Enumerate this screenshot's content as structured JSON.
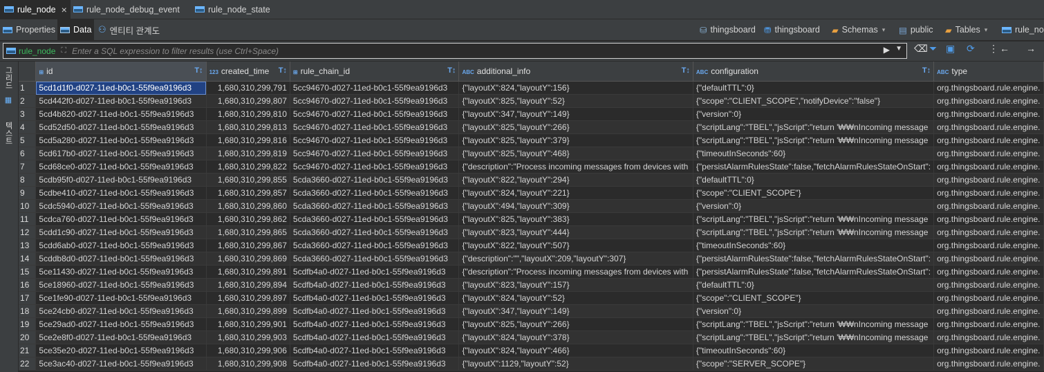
{
  "tabs": [
    {
      "label": "rule_node",
      "active": true,
      "close": "×"
    },
    {
      "label": "rule_node_debug_event",
      "active": false
    },
    {
      "label": "rule_node_state",
      "active": false
    }
  ],
  "toolbar": {
    "properties": "Properties",
    "data": "Data",
    "er": "엔티티 관계도",
    "conn1": "thingsboard",
    "conn2": "thingsboard",
    "schemas": "Schemas",
    "schema": "public",
    "tables": "Tables",
    "table": "rule_no"
  },
  "filter": {
    "table_name": "rule_node",
    "placeholder": "Enter a SQL expression to filter results (use Ctrl+Space)"
  },
  "side_tabs": [
    "그리드",
    "텍스트"
  ],
  "columns": [
    {
      "type": "id",
      "name": "id"
    },
    {
      "type": "123",
      "name": "created_time"
    },
    {
      "type": "id",
      "name": "rule_chain_id"
    },
    {
      "type": "ABC",
      "name": "additional_info"
    },
    {
      "type": "ABC",
      "name": "configuration"
    },
    {
      "type": "ABC",
      "name": "type"
    }
  ],
  "rows": [
    [
      "1",
      "5cd1d1f0-d027-11ed-b0c1-55f9ea9196d3",
      "1,680,310,299,791",
      "5cc94670-d027-11ed-b0c1-55f9ea9196d3",
      "{\"layoutX\":824,\"layoutY\":156}",
      "{\"defaultTTL\":0}",
      "org.thingsboard.rule.engine."
    ],
    [
      "2",
      "5cd442f0-d027-11ed-b0c1-55f9ea9196d3",
      "1,680,310,299,807",
      "5cc94670-d027-11ed-b0c1-55f9ea9196d3",
      "{\"layoutX\":825,\"layoutY\":52}",
      "{\"scope\":\"CLIENT_SCOPE\",\"notifyDevice\":\"false\"}",
      "org.thingsboard.rule.engine."
    ],
    [
      "3",
      "5cd4b820-d027-11ed-b0c1-55f9ea9196d3",
      "1,680,310,299,810",
      "5cc94670-d027-11ed-b0c1-55f9ea9196d3",
      "{\"layoutX\":347,\"layoutY\":149}",
      "{\"version\":0}",
      "org.thingsboard.rule.engine."
    ],
    [
      "4",
      "5cd52d50-d027-11ed-b0c1-55f9ea9196d3",
      "1,680,310,299,813",
      "5cc94670-d027-11ed-b0c1-55f9ea9196d3",
      "{\"layoutX\":825,\"layoutY\":266}",
      "{\"scriptLang\":\"TBEL\",\"jsScript\":\"return '₩₩nIncoming message",
      "org.thingsboard.rule.engine."
    ],
    [
      "5",
      "5cd5a280-d027-11ed-b0c1-55f9ea9196d3",
      "1,680,310,299,816",
      "5cc94670-d027-11ed-b0c1-55f9ea9196d3",
      "{\"layoutX\":825,\"layoutY\":379}",
      "{\"scriptLang\":\"TBEL\",\"jsScript\":\"return '₩₩nIncoming message",
      "org.thingsboard.rule.engine."
    ],
    [
      "6",
      "5cd617b0-d027-11ed-b0c1-55f9ea9196d3",
      "1,680,310,299,819",
      "5cc94670-d027-11ed-b0c1-55f9ea9196d3",
      "{\"layoutX\":825,\"layoutY\":468}",
      "{\"timeoutInSeconds\":60}",
      "org.thingsboard.rule.engine."
    ],
    [
      "7",
      "5cd68ce0-d027-11ed-b0c1-55f9ea9196d3",
      "1,680,310,299,822",
      "5cc94670-d027-11ed-b0c1-55f9ea9196d3",
      "{\"description\":\"Process incoming messages from devices with",
      "{\"persistAlarmRulesState\":false,\"fetchAlarmRulesStateOnStart\":",
      "org.thingsboard.rule.engine."
    ],
    [
      "8",
      "5cdb95f0-d027-11ed-b0c1-55f9ea9196d3",
      "1,680,310,299,855",
      "5cda3660-d027-11ed-b0c1-55f9ea9196d3",
      "{\"layoutX\":822,\"layoutY\":294}",
      "{\"defaultTTL\":0}",
      "org.thingsboard.rule.engine."
    ],
    [
      "9",
      "5cdbe410-d027-11ed-b0c1-55f9ea9196d3",
      "1,680,310,299,857",
      "5cda3660-d027-11ed-b0c1-55f9ea9196d3",
      "{\"layoutX\":824,\"layoutY\":221}",
      "{\"scope\":\"CLIENT_SCOPE\"}",
      "org.thingsboard.rule.engine."
    ],
    [
      "10",
      "5cdc5940-d027-11ed-b0c1-55f9ea9196d3",
      "1,680,310,299,860",
      "5cda3660-d027-11ed-b0c1-55f9ea9196d3",
      "{\"layoutX\":494,\"layoutY\":309}",
      "{\"version\":0}",
      "org.thingsboard.rule.engine."
    ],
    [
      "11",
      "5cdca760-d027-11ed-b0c1-55f9ea9196d3",
      "1,680,310,299,862",
      "5cda3660-d027-11ed-b0c1-55f9ea9196d3",
      "{\"layoutX\":825,\"layoutY\":383}",
      "{\"scriptLang\":\"TBEL\",\"jsScript\":\"return '₩₩nIncoming message",
      "org.thingsboard.rule.engine."
    ],
    [
      "12",
      "5cdd1c90-d027-11ed-b0c1-55f9ea9196d3",
      "1,680,310,299,865",
      "5cda3660-d027-11ed-b0c1-55f9ea9196d3",
      "{\"layoutX\":823,\"layoutY\":444}",
      "{\"scriptLang\":\"TBEL\",\"jsScript\":\"return '₩₩nIncoming message",
      "org.thingsboard.rule.engine."
    ],
    [
      "13",
      "5cdd6ab0-d027-11ed-b0c1-55f9ea9196d3",
      "1,680,310,299,867",
      "5cda3660-d027-11ed-b0c1-55f9ea9196d3",
      "{\"layoutX\":822,\"layoutY\":507}",
      "{\"timeoutInSeconds\":60}",
      "org.thingsboard.rule.engine."
    ],
    [
      "14",
      "5cddb8d0-d027-11ed-b0c1-55f9ea9196d3",
      "1,680,310,299,869",
      "5cda3660-d027-11ed-b0c1-55f9ea9196d3",
      "{\"description\":\"\",\"layoutX\":209,\"layoutY\":307}",
      "{\"persistAlarmRulesState\":false,\"fetchAlarmRulesStateOnStart\":",
      "org.thingsboard.rule.engine."
    ],
    [
      "15",
      "5ce11430-d027-11ed-b0c1-55f9ea9196d3",
      "1,680,310,299,891",
      "5cdfb4a0-d027-11ed-b0c1-55f9ea9196d3",
      "{\"description\":\"Process incoming messages from devices with",
      "{\"persistAlarmRulesState\":false,\"fetchAlarmRulesStateOnStart\":",
      "org.thingsboard.rule.engine."
    ],
    [
      "16",
      "5ce18960-d027-11ed-b0c1-55f9ea9196d3",
      "1,680,310,299,894",
      "5cdfb4a0-d027-11ed-b0c1-55f9ea9196d3",
      "{\"layoutX\":823,\"layoutY\":157}",
      "{\"defaultTTL\":0}",
      "org.thingsboard.rule.engine."
    ],
    [
      "17",
      "5ce1fe90-d027-11ed-b0c1-55f9ea9196d3",
      "1,680,310,299,897",
      "5cdfb4a0-d027-11ed-b0c1-55f9ea9196d3",
      "{\"layoutX\":824,\"layoutY\":52}",
      "{\"scope\":\"CLIENT_SCOPE\"}",
      "org.thingsboard.rule.engine."
    ],
    [
      "18",
      "5ce24cb0-d027-11ed-b0c1-55f9ea9196d3",
      "1,680,310,299,899",
      "5cdfb4a0-d027-11ed-b0c1-55f9ea9196d3",
      "{\"layoutX\":347,\"layoutY\":149}",
      "{\"version\":0}",
      "org.thingsboard.rule.engine."
    ],
    [
      "19",
      "5ce29ad0-d027-11ed-b0c1-55f9ea9196d3",
      "1,680,310,299,901",
      "5cdfb4a0-d027-11ed-b0c1-55f9ea9196d3",
      "{\"layoutX\":825,\"layoutY\":266}",
      "{\"scriptLang\":\"TBEL\",\"jsScript\":\"return '₩₩nIncoming message",
      "org.thingsboard.rule.engine."
    ],
    [
      "20",
      "5ce2e8f0-d027-11ed-b0c1-55f9ea9196d3",
      "1,680,310,299,903",
      "5cdfb4a0-d027-11ed-b0c1-55f9ea9196d3",
      "{\"layoutX\":824,\"layoutY\":378}",
      "{\"scriptLang\":\"TBEL\",\"jsScript\":\"return '₩₩nIncoming message",
      "org.thingsboard.rule.engine."
    ],
    [
      "21",
      "5ce35e20-d027-11ed-b0c1-55f9ea9196d3",
      "1,680,310,299,906",
      "5cdfb4a0-d027-11ed-b0c1-55f9ea9196d3",
      "{\"layoutX\":824,\"layoutY\":466}",
      "{\"timeoutInSeconds\":60}",
      "org.thingsboard.rule.engine."
    ],
    [
      "22",
      "5ce3ac40-d027-11ed-b0c1-55f9ea9196d3",
      "1,680,310,299,908",
      "5cdfb4a0-d027-11ed-b0c1-55f9ea9196d3",
      "{\"layoutX\":1129,\"layoutY\":52}",
      "{\"scope\":\"SERVER_SCOPE\"}",
      "org.thingsboard.rule.engine."
    ]
  ],
  "colors": {
    "background": "#2b2b2b",
    "panel": "#3c3f41",
    "selection": "#214283",
    "accent": "#6aa9f0",
    "table_name": "#3cba5e"
  }
}
